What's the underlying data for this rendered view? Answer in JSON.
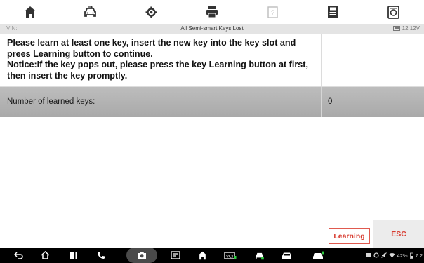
{
  "toolbar": {
    "buttons": [
      {
        "name": "home",
        "icon": "home-icon"
      },
      {
        "name": "vehicle",
        "icon": "car-swap-icon"
      },
      {
        "name": "settings",
        "icon": "gear-icon"
      },
      {
        "name": "print",
        "icon": "printer-icon"
      },
      {
        "name": "help",
        "icon": "help-icon"
      },
      {
        "name": "save",
        "icon": "save-icon"
      },
      {
        "name": "datalog",
        "icon": "datalog-icon"
      }
    ]
  },
  "titlebar": {
    "vin_label": "VIN:",
    "title": "All Semi-smart Keys Lost",
    "voltage": "12.12V"
  },
  "instruction": {
    "text": "Please learn at least one key, insert the new key into the key slot and prees Learning button to continue.\nNotice:If the key pops out, please press the key Learning button at first, then insert the key promptly."
  },
  "learned_keys": {
    "label": "Number of learned keys:",
    "value": "0"
  },
  "function_bar": {
    "learning_label": "Learning",
    "esc_label": "ESC"
  },
  "status_bar": {
    "battery": "42%",
    "time": "7:2"
  },
  "colors": {
    "accent": "#d83b2f",
    "row_background": "#b3b3b3",
    "title_bar": "#e4e4e4",
    "nav_bar": "#000000"
  }
}
